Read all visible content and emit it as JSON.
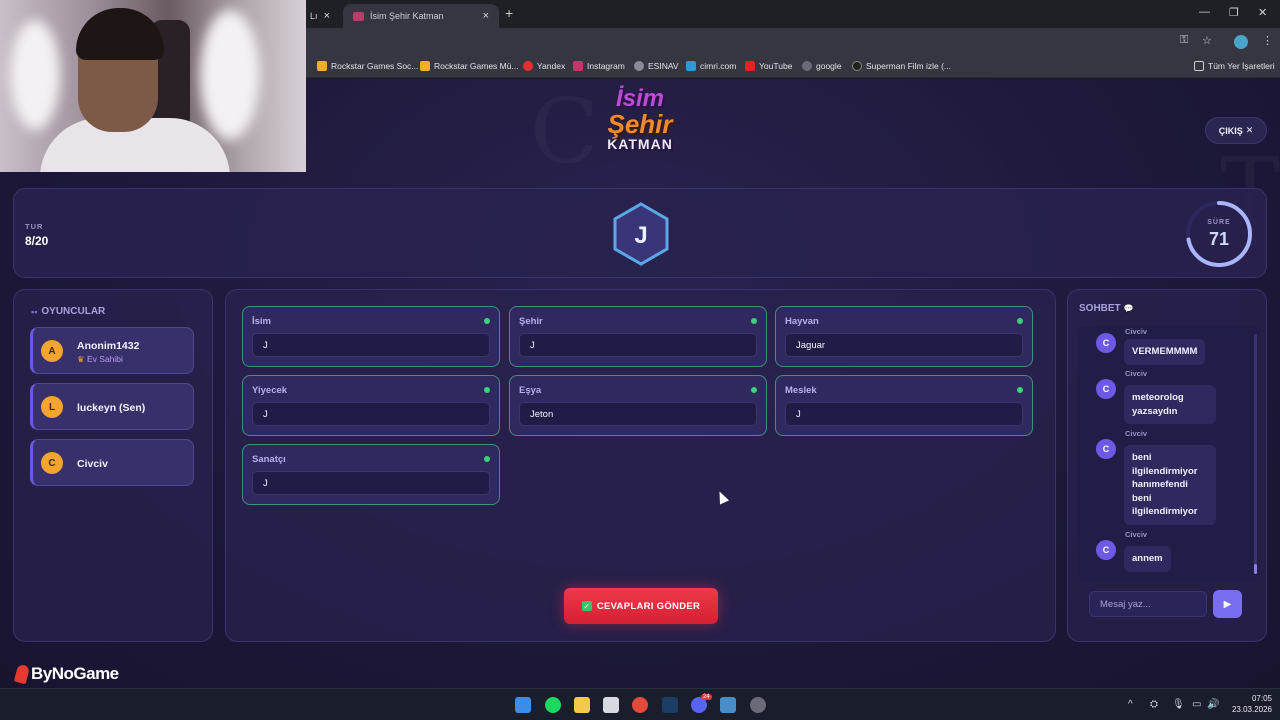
{
  "browser": {
    "tabs": [
      {
        "label": "Lı"
      },
      {
        "label": "İsim Şehir Katman"
      }
    ],
    "new_tab": "+",
    "bookmarks": [
      {
        "label": "Rockstar Games Soc...",
        "color": "#f0b020"
      },
      {
        "label": "Rockstar Games Mü...",
        "color": "#f0b020"
      },
      {
        "label": "Yandex",
        "color": "#e83030"
      },
      {
        "label": "Instagram",
        "color": "#d0306a"
      },
      {
        "label": "ESINAV",
        "color": "#8a8a96"
      },
      {
        "label": "cimri.com",
        "color": "#2a9ad8"
      },
      {
        "label": "YouTube",
        "color": "#e82020"
      },
      {
        "label": "google",
        "color": "#6a6a76"
      },
      {
        "label": "Superman Film izle (...",
        "color": "#202020"
      }
    ],
    "all_bookmarks": "Tüm Yer İşaretleri"
  },
  "game": {
    "logo": {
      "line1": "İsim",
      "line2": "Şehir",
      "line3": "KATMAN"
    },
    "exit_label": "ÇIKIŞ",
    "round_label": "TUR",
    "round_value": "8/20",
    "letter": "J",
    "timer_label": "SÜRE",
    "timer_value": "71",
    "timer_fraction": 0.72,
    "players_title": "OYUNCULAR",
    "players": [
      {
        "initial": "A",
        "name": "Anonim1432",
        "role": "Ev Sahibi",
        "color": "#f3a530"
      },
      {
        "initial": "L",
        "name": "luckeyn (Sen)",
        "role": "",
        "color": "#f3a530"
      },
      {
        "initial": "C",
        "name": "Civciv",
        "role": "",
        "color": "#f3a530"
      }
    ],
    "fields": [
      {
        "label": "İsim",
        "value": "J"
      },
      {
        "label": "Şehir",
        "value": "J"
      },
      {
        "label": "Hayvan",
        "value": "Jaguar"
      },
      {
        "label": "Yiyecek",
        "value": "J"
      },
      {
        "label": "Eşya",
        "value": "Jeton"
      },
      {
        "label": "Meslek",
        "value": "J"
      },
      {
        "label": "Sanatçı",
        "value": "J"
      }
    ],
    "submit_label": "CEVAPLARI GÖNDER",
    "chat_title": "SOHBET",
    "chat_messages": [
      {
        "initial": "C",
        "user": "Civciv",
        "text": "VERMEMMMM"
      },
      {
        "initial": "C",
        "user": "Civciv",
        "text": "meteorolog yazsaydın"
      },
      {
        "initial": "C",
        "user": "Civciv",
        "text": "beni ilgilendirmiyor hanımefendi beni ilgilendirmiyor"
      },
      {
        "initial": "C",
        "user": "Civciv",
        "text": "annem"
      }
    ],
    "chat_placeholder": "Mesaj yaz..."
  },
  "watermark": "ByNoGame",
  "taskbar": {
    "time": "07:05",
    "date": "23.03.2026",
    "discord_badge": "24"
  }
}
